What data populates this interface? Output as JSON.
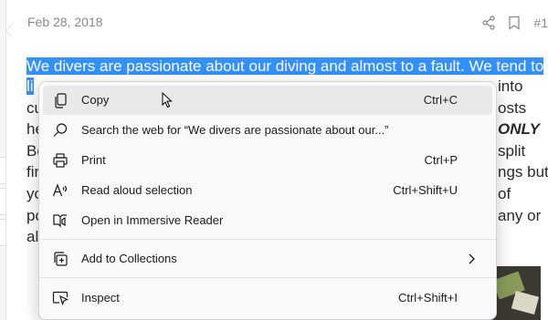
{
  "post": {
    "date": "Feb 28, 2018",
    "number": "#1",
    "lines": [
      "We divers are passionate about our diving and almost to a fault. We tend to",
      "li",
      "cu",
      "he",
      "Bo",
      "fir",
      "yo",
      "po",
      "al"
    ],
    "right_fragments": [
      "into",
      "osts",
      "ONLY",
      "split",
      "ngs but",
      "of",
      "any or"
    ]
  },
  "context_menu": {
    "items": [
      {
        "label": "Copy",
        "shortcut": "Ctrl+C",
        "icon": "copy-icon"
      },
      {
        "label": "Search the web for “We divers are passionate about our...”",
        "shortcut": "",
        "icon": "search-icon"
      },
      {
        "label": "Print",
        "shortcut": "Ctrl+P",
        "icon": "print-icon"
      },
      {
        "label": "Read aloud selection",
        "shortcut": "Ctrl+Shift+U",
        "icon": "read-aloud-icon"
      },
      {
        "label": "Open in Immersive Reader",
        "shortcut": "",
        "icon": "immersive-reader-icon"
      },
      {
        "label": "Add to Collections",
        "shortcut": "",
        "icon": "collections-icon"
      },
      {
        "label": "Inspect",
        "shortcut": "Ctrl+Shift+I",
        "icon": "inspect-icon"
      }
    ]
  },
  "colors": {
    "selection": "#3390ff",
    "menu_background": "#f9f9f9",
    "menu_hover": "#e9e9e9"
  }
}
